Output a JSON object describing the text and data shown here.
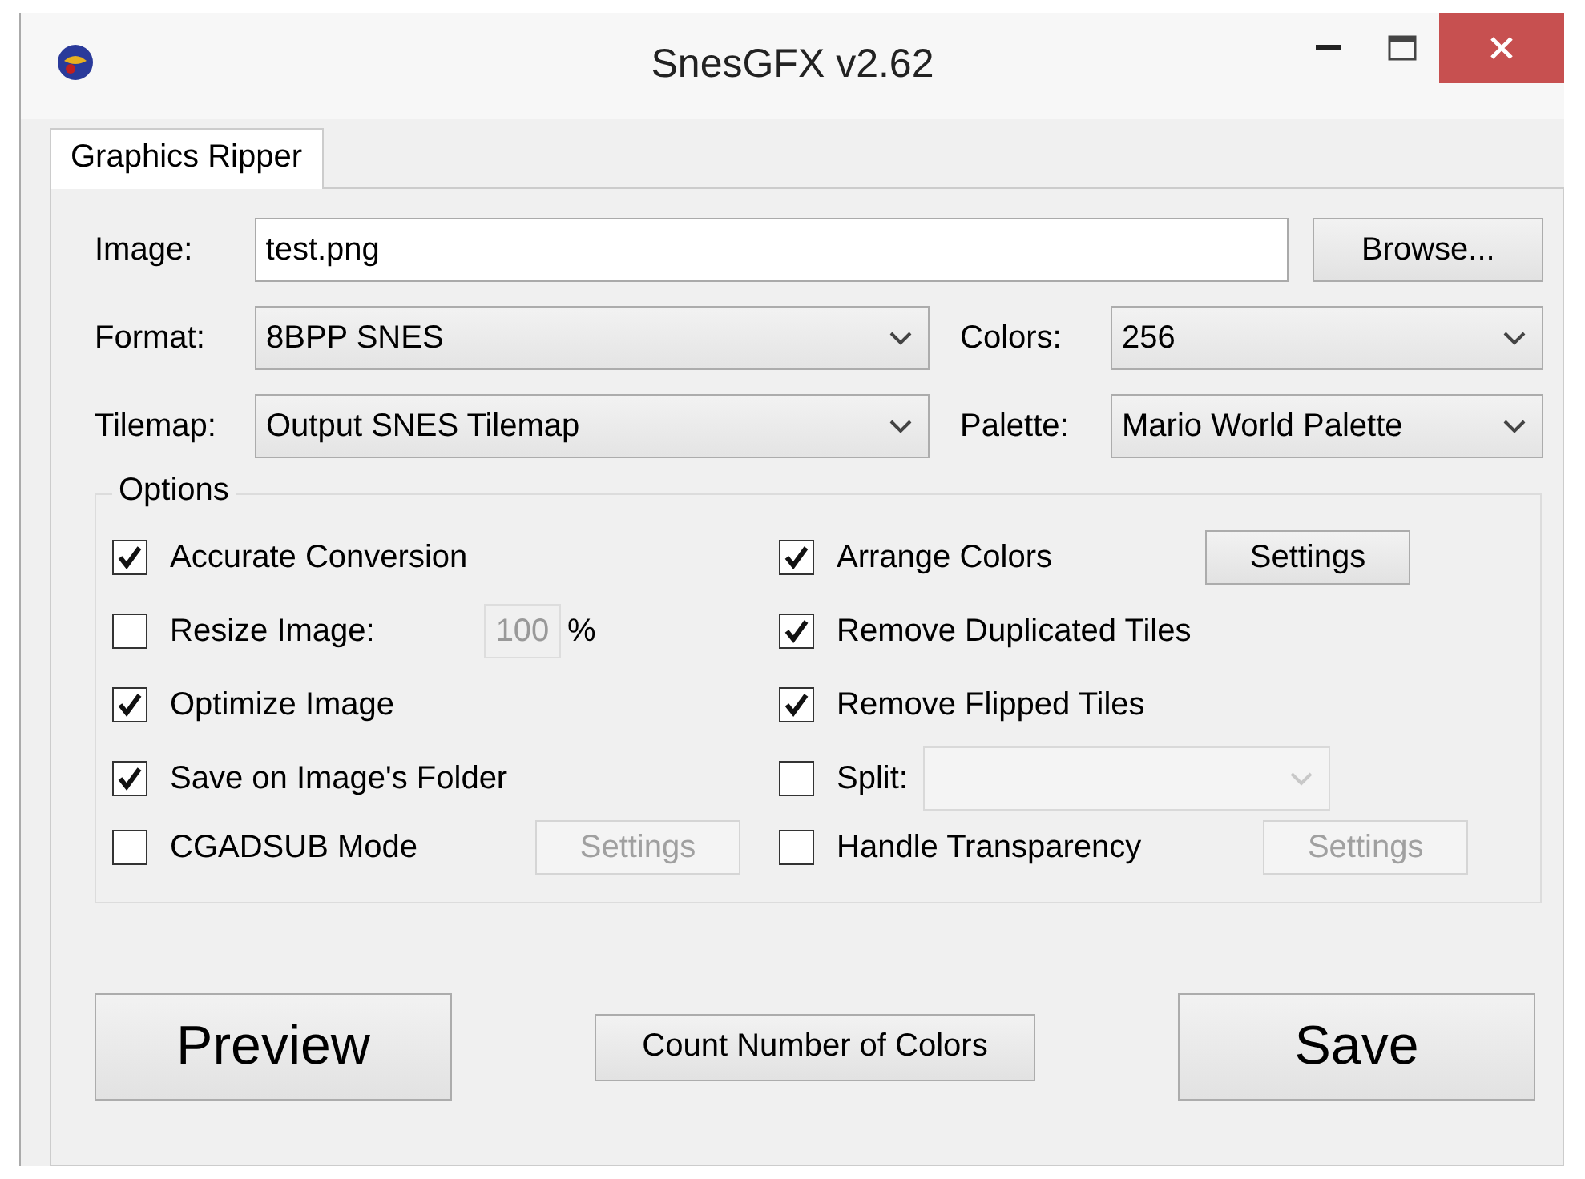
{
  "window": {
    "title": "SnesGFX v2.62"
  },
  "tabs": [
    {
      "label": "Graphics Ripper",
      "selected": true
    }
  ],
  "image": {
    "label": "Image:",
    "value": "test.png",
    "button": "Browse..."
  },
  "format": {
    "label": "Format:",
    "value": "8BPP SNES"
  },
  "colors": {
    "label": "Colors:",
    "value": "256"
  },
  "tilemap": {
    "label": "Tilemap:",
    "value": "Output SNES Tilemap"
  },
  "palette": {
    "label": "Palette:",
    "value": "Mario World Palette"
  },
  "options": {
    "title": "Options",
    "left": [
      {
        "label": "Accurate Conversion",
        "checked": true,
        "kind": "plain"
      },
      {
        "label": "Resize Image:",
        "checked": false,
        "kind": "percent",
        "value": "100",
        "unit": "%",
        "disabled": true
      },
      {
        "label": "Optimize Image",
        "checked": true,
        "kind": "plain"
      },
      {
        "label": "Save on Image's Folder",
        "checked": true,
        "kind": "plain"
      },
      {
        "label": "CGADSUB Mode",
        "checked": false,
        "kind": "button",
        "button": "Settings",
        "disabled": true
      }
    ],
    "right": [
      {
        "label": "Arrange Colors",
        "checked": true,
        "kind": "button",
        "button": "Settings",
        "disabled": false
      },
      {
        "label": "Remove Duplicated Tiles",
        "checked": true,
        "kind": "plain"
      },
      {
        "label": "Remove Flipped Tiles",
        "checked": true,
        "kind": "plain"
      },
      {
        "label": "Split:",
        "checked": false,
        "kind": "select",
        "disabled": true
      },
      {
        "label": "Handle Transparency",
        "checked": false,
        "kind": "button",
        "button": "Settings",
        "disabled": true
      }
    ]
  },
  "buttons": [
    {
      "label": "Preview",
      "kind": "large"
    },
    {
      "label": "Count Number of Colors",
      "kind": "small"
    },
    {
      "label": "Save",
      "kind": "large"
    }
  ]
}
